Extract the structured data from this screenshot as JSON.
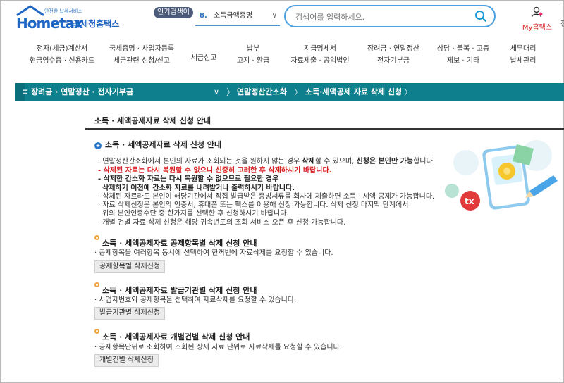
{
  "header": {
    "logo_small": "안전한 납세서비스",
    "logo_main": "Hometax",
    "logo_sub": "국세청홈택스",
    "popular_badge": "인기검색어",
    "popular_num": "8.",
    "popular_term": "소득금액증명",
    "search_placeholder": "검색어를 입력하세요.",
    "myhome_label": "My홈택스",
    "edge_text": "전"
  },
  "nav": [
    {
      "line1": "전자(세금)계산서",
      "line2": "현금영수증 · 신용카드"
    },
    {
      "line1": "국세증명 · 사업자등록",
      "line2": "세금관련 신청/신고"
    },
    {
      "line1": "세금신고",
      "line2": ""
    },
    {
      "line1": "납부",
      "line2": "고지 · 환급"
    },
    {
      "line1": "지급명세서",
      "line2": "자료제출 · 공익법인"
    },
    {
      "line1": "장려금 · 연말정산",
      "line2": "전자기부금"
    },
    {
      "line1": "상담 · 불복 · 고충",
      "line2": "제보 · 기타"
    },
    {
      "line1": "세무대리",
      "line2": "납세관리"
    }
  ],
  "breadcrumb": {
    "menu": "≡  장려금 · 연말정산 · 전자기부금",
    "item1": "연말정산간소화",
    "item2": "소득·세액공제 자료 삭제 신청"
  },
  "content": {
    "page_title": "소득 · 세액공제자료 삭제 신청 안내",
    "main_heading": "소득 · 세액공제자료 삭제 신청 안내",
    "lines": {
      "l1a": "· 연말정산간소화에서 본인의 자료가 조회되는 것을 원하지 않는 경우 ",
      "l1b": "삭제",
      "l1c": "할 수 있으며, ",
      "l1d": "신청은 본인만 가능",
      "l1e": "합니다.",
      "l2": "- 삭제된 자료는 다시 복원할 수 없으니 신중히 고려한 후 삭제하시기 바랍니다.",
      "l3": "- 삭제한 간소화 자료는 다시 복원할 수 없으므로 필요한 경우",
      "l4": "삭제하기 이전에 간소화 자료를 내려받거나 출력하시기 바랍니다.",
      "l5": "· 삭제된 자료라도 본인이 해당기관에서 직접 발급받은 증빙서류를 회사에 제출하면 소득 · 세액 공제가 가능합니다.",
      "l6": "· 자료 삭제신청은 본인의 인증서, 휴대폰 또는 팩스를 이용해 신청 가능합니다. 삭제 신청 마지막 단계에서",
      "l7": "위의 본인인증수단 중 한가지를 선택한 후 신청하시기 바랍니다.",
      "l8": "· 개별 건별 자료 삭제 신청은 해당 귀속년도의 조회 서비스 오픈 후 신청 가능합니다."
    },
    "sections": [
      {
        "heading": "소득 · 세액공제자료 공제항목별 삭제 신청 안내",
        "desc": "· 공제항목을 여러항목 동시에 선택하여 한꺼번에 자료삭제를 요청할 수 있습니다.",
        "button": "공제항목별 삭제신청"
      },
      {
        "heading": "소득 · 세액공제자료 발급기관별 삭제 신청 안내",
        "desc": "· 사업자번호와 공제항목을 선택하여 자료삭제를 요청할 수 있습니다.",
        "button": "발급기관별 삭제신청"
      },
      {
        "heading": "소득 · 세액공제자료 개별건별 삭제 신청 안내",
        "desc": "· 공제항목단위로 조회하여 조회된 상세 자료 단위로 자료삭제를 요청할 수 있습니다.",
        "button": "개별건별 삭제신청"
      }
    ]
  },
  "colors": {
    "brand": "#1f66c4",
    "breadcrumb_bg": "#0e7f8c",
    "warning": "#d8201f",
    "accent_orange": "#f2a03a"
  }
}
